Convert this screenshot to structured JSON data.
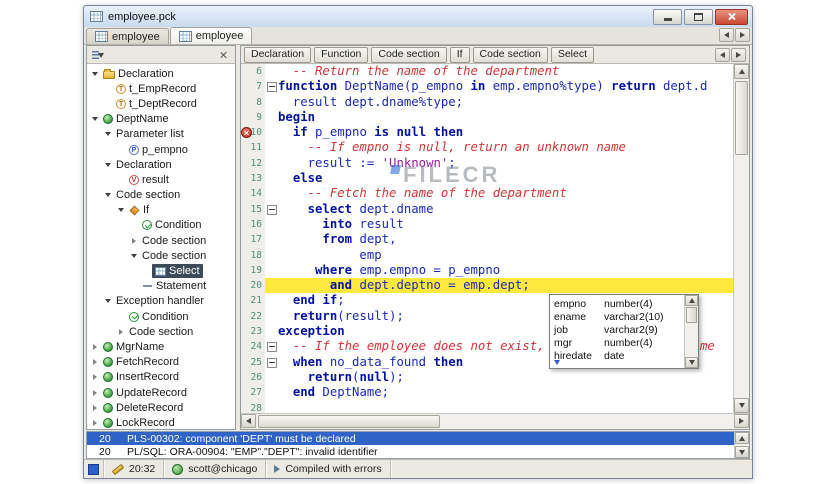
{
  "window": {
    "title": "employee.pck"
  },
  "tabs": [
    {
      "label": "employee",
      "active": false
    },
    {
      "label": "employee",
      "active": true
    }
  ],
  "tree": {
    "items": [
      {
        "label": "Declaration",
        "depth": 0,
        "exp": "open",
        "icon": "folder"
      },
      {
        "label": "t_EmpRecord",
        "depth": 1,
        "exp": "none",
        "icon": "type"
      },
      {
        "label": "t_DeptRecord",
        "depth": 1,
        "exp": "none",
        "icon": "type"
      },
      {
        "label": "DeptName",
        "depth": 0,
        "exp": "open",
        "icon": "func"
      },
      {
        "label": "Parameter list",
        "depth": 1,
        "exp": "open",
        "icon": "none"
      },
      {
        "label": "p_empno",
        "depth": 2,
        "exp": "none",
        "icon": "param"
      },
      {
        "label": "Declaration",
        "depth": 1,
        "exp": "open",
        "icon": "none"
      },
      {
        "label": "result",
        "depth": 2,
        "exp": "none",
        "icon": "var"
      },
      {
        "label": "Code section",
        "depth": 1,
        "exp": "open",
        "icon": "none"
      },
      {
        "label": "If",
        "depth": 2,
        "exp": "open",
        "icon": "if"
      },
      {
        "label": "Condition",
        "depth": 3,
        "exp": "none",
        "icon": "check"
      },
      {
        "label": "Code section",
        "depth": 3,
        "exp": "closed",
        "icon": "none"
      },
      {
        "label": "Code section",
        "depth": 3,
        "exp": "open",
        "icon": "none"
      },
      {
        "label": "Select",
        "depth": 4,
        "exp": "none",
        "icon": "select",
        "selected": true
      },
      {
        "label": "Statement",
        "depth": 3,
        "exp": "none",
        "icon": "stmt"
      },
      {
        "label": "Exception handler",
        "depth": 1,
        "exp": "open",
        "icon": "none"
      },
      {
        "label": "Condition",
        "depth": 2,
        "exp": "none",
        "icon": "check"
      },
      {
        "label": "Code section",
        "depth": 2,
        "exp": "closed",
        "icon": "none"
      },
      {
        "label": "MgrName",
        "depth": 0,
        "exp": "closed",
        "icon": "func"
      },
      {
        "label": "FetchRecord",
        "depth": 0,
        "exp": "closed",
        "icon": "func"
      },
      {
        "label": "InsertRecord",
        "depth": 0,
        "exp": "closed",
        "icon": "func"
      },
      {
        "label": "UpdateRecord",
        "depth": 0,
        "exp": "closed",
        "icon": "func"
      },
      {
        "label": "DeleteRecord",
        "depth": 0,
        "exp": "closed",
        "icon": "func"
      },
      {
        "label": "LockRecord",
        "depth": 0,
        "exp": "closed",
        "icon": "func"
      }
    ]
  },
  "toolbar": {
    "buttons": [
      "Declaration",
      "Function",
      "Code section",
      "If",
      "Code section",
      "Select"
    ]
  },
  "editor": {
    "lines": [
      {
        "n": 6,
        "seg": [
          [
            "c",
            "  -- Return the name of the department"
          ]
        ]
      },
      {
        "n": 7,
        "fold": true,
        "seg": [
          [
            "k",
            "function"
          ],
          [
            "p",
            " DeptName(p_empno "
          ],
          [
            "k",
            "in"
          ],
          [
            "p",
            " emp.empno%type) "
          ],
          [
            "k",
            "return"
          ],
          [
            "p",
            " dept.d"
          ]
        ]
      },
      {
        "n": 8,
        "seg": [
          [
            "p",
            "  result dept.dname%type;"
          ]
        ]
      },
      {
        "n": 9,
        "seg": [
          [
            "k",
            "begin"
          ]
        ]
      },
      {
        "n": 10,
        "err": true,
        "seg": [
          [
            "p",
            "  "
          ],
          [
            "k",
            "if"
          ],
          [
            "p",
            " p_empno "
          ],
          [
            "k",
            "is"
          ],
          [
            "p",
            " "
          ],
          [
            "k",
            "null"
          ],
          [
            "p",
            " "
          ],
          [
            "k",
            "then"
          ]
        ]
      },
      {
        "n": 11,
        "seg": [
          [
            "c",
            "    -- If empno is null, return an unknown name"
          ]
        ]
      },
      {
        "n": 12,
        "seg": [
          [
            "p",
            "    result := "
          ],
          [
            "s",
            "'Unknown'"
          ],
          [
            "p",
            ";"
          ]
        ]
      },
      {
        "n": 13,
        "seg": [
          [
            "p",
            "  "
          ],
          [
            "k",
            "else"
          ]
        ]
      },
      {
        "n": 14,
        "seg": [
          [
            "c",
            "    -- Fetch the name of the department"
          ]
        ]
      },
      {
        "n": 15,
        "fold": true,
        "seg": [
          [
            "p",
            "    "
          ],
          [
            "k",
            "select"
          ],
          [
            "p",
            " dept.dname"
          ]
        ]
      },
      {
        "n": 16,
        "seg": [
          [
            "p",
            "      "
          ],
          [
            "k",
            "into"
          ],
          [
            "p",
            " result"
          ]
        ]
      },
      {
        "n": 17,
        "seg": [
          [
            "p",
            "      "
          ],
          [
            "k",
            "from"
          ],
          [
            "p",
            " dept,"
          ]
        ]
      },
      {
        "n": 18,
        "seg": [
          [
            "p",
            "           emp"
          ]
        ]
      },
      {
        "n": 19,
        "seg": [
          [
            "p",
            "     "
          ],
          [
            "k",
            "where"
          ],
          [
            "p",
            " emp.empno = p_empno"
          ]
        ]
      },
      {
        "n": 20,
        "hl": true,
        "seg": [
          [
            "p",
            "       "
          ],
          [
            "k",
            "and"
          ],
          [
            "p",
            " dept.deptno = emp.dept;"
          ]
        ]
      },
      {
        "n": 21,
        "seg": [
          [
            "p",
            "  "
          ],
          [
            "k",
            "end"
          ],
          [
            "p",
            " "
          ],
          [
            "k",
            "if"
          ],
          [
            "p",
            ";"
          ]
        ]
      },
      {
        "n": 22,
        "seg": [
          [
            "p",
            "  "
          ],
          [
            "k",
            "return"
          ],
          [
            "p",
            "(result);"
          ]
        ]
      },
      {
        "n": 23,
        "seg": [
          [
            "k",
            "exception"
          ]
        ]
      },
      {
        "n": 24,
        "fold": true,
        "seg": [
          [
            "c",
            "  -- If the employee does not exist, return an unknown name"
          ]
        ]
      },
      {
        "n": 25,
        "fold": true,
        "seg": [
          [
            "p",
            "  "
          ],
          [
            "k",
            "when"
          ],
          [
            "p",
            " no_data_found "
          ],
          [
            "k",
            "then"
          ]
        ]
      },
      {
        "n": 26,
        "seg": [
          [
            "p",
            "    "
          ],
          [
            "k",
            "return"
          ],
          [
            "p",
            "("
          ],
          [
            "k",
            "null"
          ],
          [
            "p",
            ");"
          ]
        ]
      },
      {
        "n": 27,
        "seg": [
          [
            "p",
            "  "
          ],
          [
            "k",
            "end"
          ],
          [
            "p",
            " DeptName;"
          ]
        ]
      },
      {
        "n": 28,
        "seg": []
      }
    ]
  },
  "completion_popup": {
    "items": [
      [
        "empno",
        "number(4)"
      ],
      [
        "ename",
        "varchar2(10)"
      ],
      [
        "job",
        "varchar2(9)"
      ],
      [
        "mgr",
        "number(4)"
      ],
      [
        "hiredate",
        "date"
      ]
    ]
  },
  "errors": [
    {
      "line": "20",
      "message": "PLS-00302: component 'DEPT' must be declared",
      "selected": true
    },
    {
      "line": "20",
      "message": "PL/SQL: ORA-00904: \"EMP\".\"DEPT\": invalid identifier",
      "selected": false
    }
  ],
  "statusbar": {
    "position": "20:32",
    "session": "scott@chicago",
    "message": "Compiled with errors"
  },
  "watermark": "FILECR",
  "colors": {
    "selection_blue": "#2f63c5",
    "line_highlight_yellow": "#ffe93e",
    "error_red": "#c22818",
    "keyword_navy": "#00129f",
    "comment_red": "#d13535",
    "string_purple": "#8e1f9e",
    "tree_selection": "#3c4a57"
  },
  "icons": {
    "app-icon": "grid",
    "minimize-icon": "bar",
    "maximize-icon": "square",
    "close-icon": "cross",
    "sort-icon": "sort-lines",
    "close-panel-icon": "cross",
    "folder-icon": "folder",
    "func-icon": "green-ball",
    "type-icon": "circle-T",
    "param-icon": "circle-P",
    "var-icon": "circle-V",
    "check-icon": "checkmark",
    "if-icon": "diamond",
    "select-icon": "grid",
    "stmt-icon": "dash",
    "fold-marker-icon": "minus-box",
    "error-marker-icon": "red-circle-cross",
    "modified-icon": "blue-square",
    "edit-icon": "pencil",
    "session-icon": "green-ball",
    "compile-icon": "arrow-right"
  }
}
